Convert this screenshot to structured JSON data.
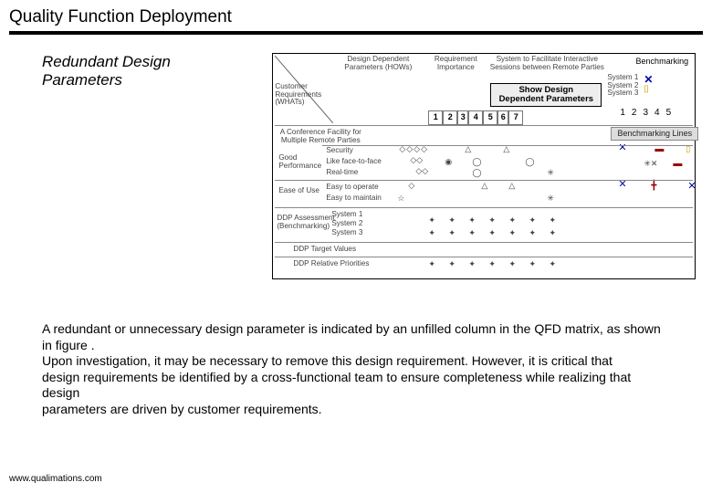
{
  "header": {
    "title": "Quality Function Deployment"
  },
  "subtitle": "Redundant Design Parameters",
  "diagram": {
    "ddp_label": "Design Dependent\nParameters (HOWs)",
    "req_imp": "Requirement\nImportance",
    "sys_fac": "System to Facilitate Interactive\nSessions between Remote Parties",
    "benchmarking": "Benchmarking",
    "show_ddp": "Show Design\nDependent Parameters",
    "cust_req": "Customer\nRequirements\n(WHATs)",
    "systems": [
      "System 1",
      "System 2",
      "System 3"
    ],
    "howcols": [
      "1",
      "2",
      "3",
      "4",
      "5",
      "6",
      "7"
    ],
    "bench_cols": [
      "1",
      "2",
      "3",
      "4",
      "5"
    ],
    "conf": "A Conference Facility for\nMultiple Remote Parties",
    "bench_lines": "Benchmarking Lines",
    "rowgroups": [
      {
        "group": "Good\nPerformance",
        "rows": [
          "Security",
          "Like face-to-face",
          "Real-time"
        ]
      },
      {
        "group": "Ease of Use",
        "rows": [
          "Easy to operate",
          "Easy to maintain"
        ]
      }
    ],
    "ddp_assess": "DDP Assessment\n(Benchmarking)",
    "assess_sys": [
      "System 1",
      "System 2",
      "System 3"
    ],
    "ddp_target": "DDP Target Values",
    "ddp_rel": "DDP Relative Priorities"
  },
  "body": {
    "p1": "A redundant or unnecessary design parameter is indicated by an unfilled column in the QFD matrix, as shown in figure .",
    "p2": "Upon investigation, it may be necessary to remove this design requirement. However, it is critical that",
    "p3": "design requirements be identified by a cross-functional team to ensure completeness while realizing that design",
    "p4": "parameters are driven by customer requirements."
  },
  "footer": "www.qualimations.com"
}
